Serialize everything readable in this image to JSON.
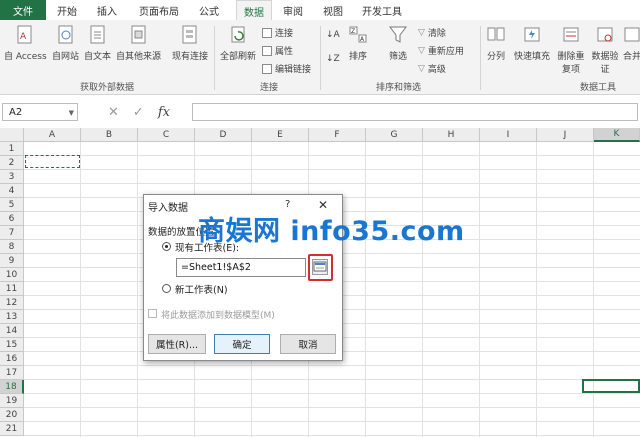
{
  "tabs": [
    {
      "label": "文件"
    },
    {
      "label": "开始"
    },
    {
      "label": "插入"
    },
    {
      "label": "页面布局"
    },
    {
      "label": "公式"
    },
    {
      "label": "数据"
    },
    {
      "label": "审阅"
    },
    {
      "label": "视图"
    },
    {
      "label": "开发工具"
    }
  ],
  "ribbon": {
    "get_external": {
      "group_label": "获取外部数据",
      "buttons": [
        "自 Access",
        "自网站",
        "自文本",
        "自其他来源",
        "现有连接"
      ]
    },
    "connections": {
      "group_label": "连接",
      "refresh_all": "全部刷新",
      "small": [
        "连接",
        "属性",
        "编辑链接"
      ]
    },
    "sort_filter": {
      "group_label": "排序和筛选",
      "sort": "排序",
      "filter": "筛选",
      "small": [
        "清除",
        "重新应用",
        "高级"
      ]
    },
    "data_tools": {
      "group_label": "数据工具",
      "buttons": [
        "分列",
        "快速填充",
        "删除重复项",
        "数据验证",
        "合并"
      ]
    }
  },
  "formula_bar": {
    "name_box": "A2",
    "fx": "fx",
    "value": ""
  },
  "columns": [
    "A",
    "B",
    "C",
    "D",
    "E",
    "F",
    "G",
    "H",
    "I",
    "J",
    "K"
  ],
  "rows": [
    "1",
    "2",
    "3",
    "4",
    "5",
    "6",
    "7",
    "8",
    "9",
    "10",
    "11",
    "12",
    "13",
    "14",
    "15",
    "16",
    "17",
    "18",
    "19",
    "20",
    "21"
  ],
  "dialog": {
    "title": "导入数据",
    "help": "?",
    "close": "✕",
    "section": "数据的放置位置",
    "opt_existing": "现有工作表(E):",
    "ref_value": "=Sheet1!$A$2",
    "opt_new": "新工作表(N)",
    "checkbox_label": "将此数据添加到数据模型(M)",
    "btn_properties": "属性(R)...",
    "btn_ok": "确定",
    "btn_cancel": "取消"
  },
  "watermark": "商娱网 info35.com"
}
